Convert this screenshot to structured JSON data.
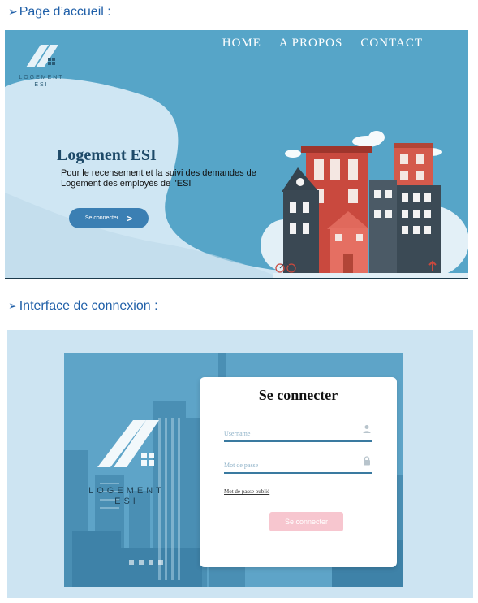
{
  "sections": {
    "home_title": "Page d’accueil :",
    "login_title": "Interface de connexion :",
    "bullet": "➢"
  },
  "home": {
    "nav": [
      "HOME",
      "A PROPOS",
      "CONTACT"
    ],
    "logo_line1": "LOGEMENT",
    "logo_line2": "ESI",
    "hero_title": "Logement ESI",
    "hero_text": "Pour le recensement et la suivi des demandes de Logement des employés de l'ESI",
    "cta_label": "Se connecter",
    "cta_icon": "chevron-right-icon"
  },
  "login": {
    "logo_line1": "LOGEMENT",
    "logo_line2": "ESI",
    "card_title": "Se connecter",
    "username_placeholder": "Username",
    "password_placeholder": "Mot de passe",
    "forgot_label": "Mot de passe oublié",
    "submit_label": "Se connecter"
  },
  "colors": {
    "hero_bg": "#56a5c8",
    "wave": "#cfe6f3",
    "button_primary": "#3b7fb3",
    "button_disabled": "#f7c6cf",
    "frame_bg": "#cde4f2"
  }
}
